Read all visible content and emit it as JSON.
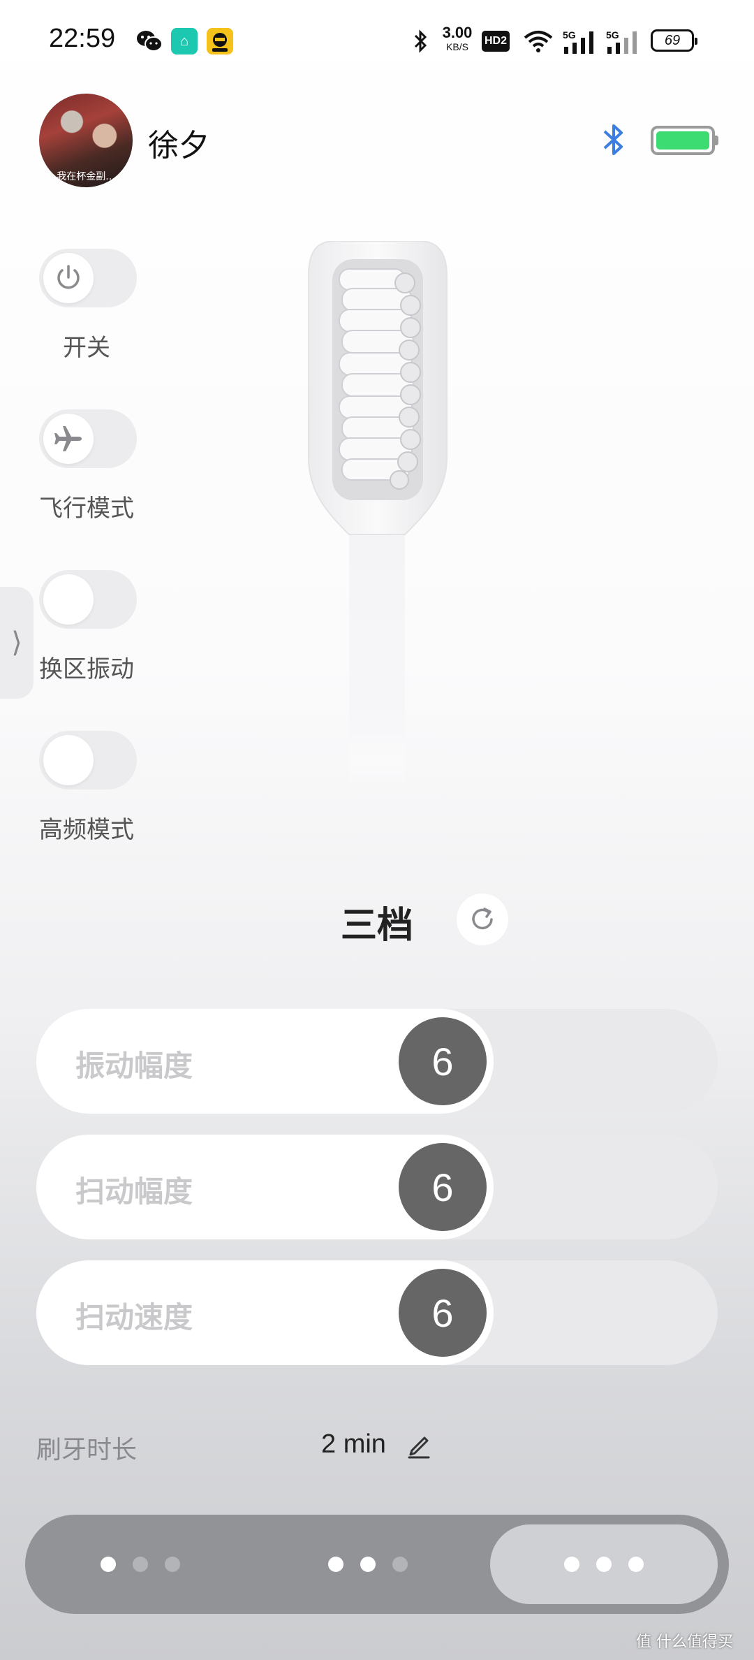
{
  "status_bar": {
    "time": "22:59",
    "net_speed_value": "3.00",
    "net_speed_unit": "KB/S",
    "hd_label": "HD2",
    "signal1_label": "5G",
    "signal2_label": "5G",
    "battery": "69"
  },
  "header": {
    "avatar_caption": "我在杯金副...",
    "user_name": "徐夕",
    "device_battery_level": 1.0,
    "device_battery_color": "#3ddc72"
  },
  "toggles": [
    {
      "label": "开关",
      "icon": "power-icon",
      "on": false
    },
    {
      "label": "飞行模式",
      "icon": "airplane-icon",
      "on": false
    },
    {
      "label": "换区振动",
      "icon": "",
      "on": false
    },
    {
      "label": "高频模式",
      "icon": "",
      "on": false
    }
  ],
  "side_handle": {
    "glyph": "⟩"
  },
  "mode": {
    "title": "三档"
  },
  "sliders": [
    {
      "label": "振动幅度",
      "value": "6",
      "level": 0.6
    },
    {
      "label": "扫动幅度",
      "value": "6",
      "level": 0.6
    },
    {
      "label": "扫动速度",
      "value": "6",
      "level": 0.6
    }
  ],
  "duration": {
    "label": "刷牙时长",
    "value": "2 min"
  },
  "bottom_nav": {
    "segments": [
      {
        "dots": [
          true,
          false,
          false
        ],
        "active": false
      },
      {
        "dots": [
          true,
          true,
          false
        ],
        "active": false
      },
      {
        "dots": [
          true,
          true,
          true
        ],
        "active": true
      }
    ]
  },
  "watermark": "值 什么值得买",
  "colors": {
    "accent_blue": "#3b7de0",
    "knob_gray": "#666666"
  }
}
